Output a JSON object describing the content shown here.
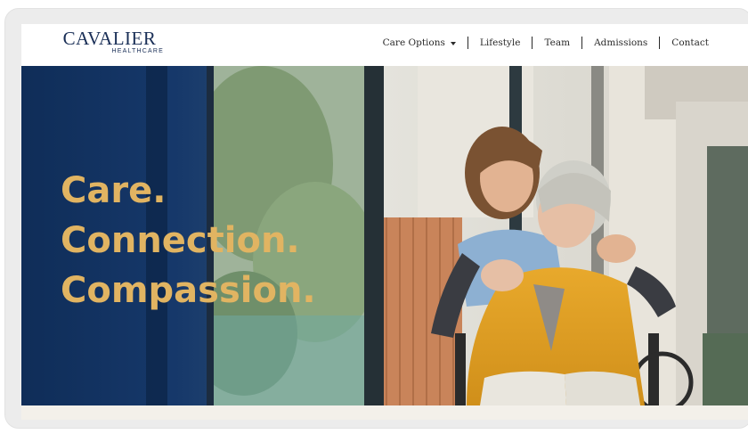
{
  "brand": {
    "name": "CAVALIER",
    "tagline": "HEALTHCARE"
  },
  "nav": {
    "items": [
      {
        "label": "Care Options",
        "has_dropdown": true
      },
      {
        "label": "Lifestyle"
      },
      {
        "label": "Team"
      },
      {
        "label": "Admissions"
      },
      {
        "label": "Contact"
      }
    ]
  },
  "hero": {
    "lines": [
      "Care.",
      "Connection.",
      "Compassion."
    ]
  },
  "colors": {
    "brand_navy": "#1a2f57",
    "hero_panel": "#123260",
    "headline_gold": "#e1b462"
  },
  "icons": {
    "dropdown": "chevron-down-icon"
  }
}
